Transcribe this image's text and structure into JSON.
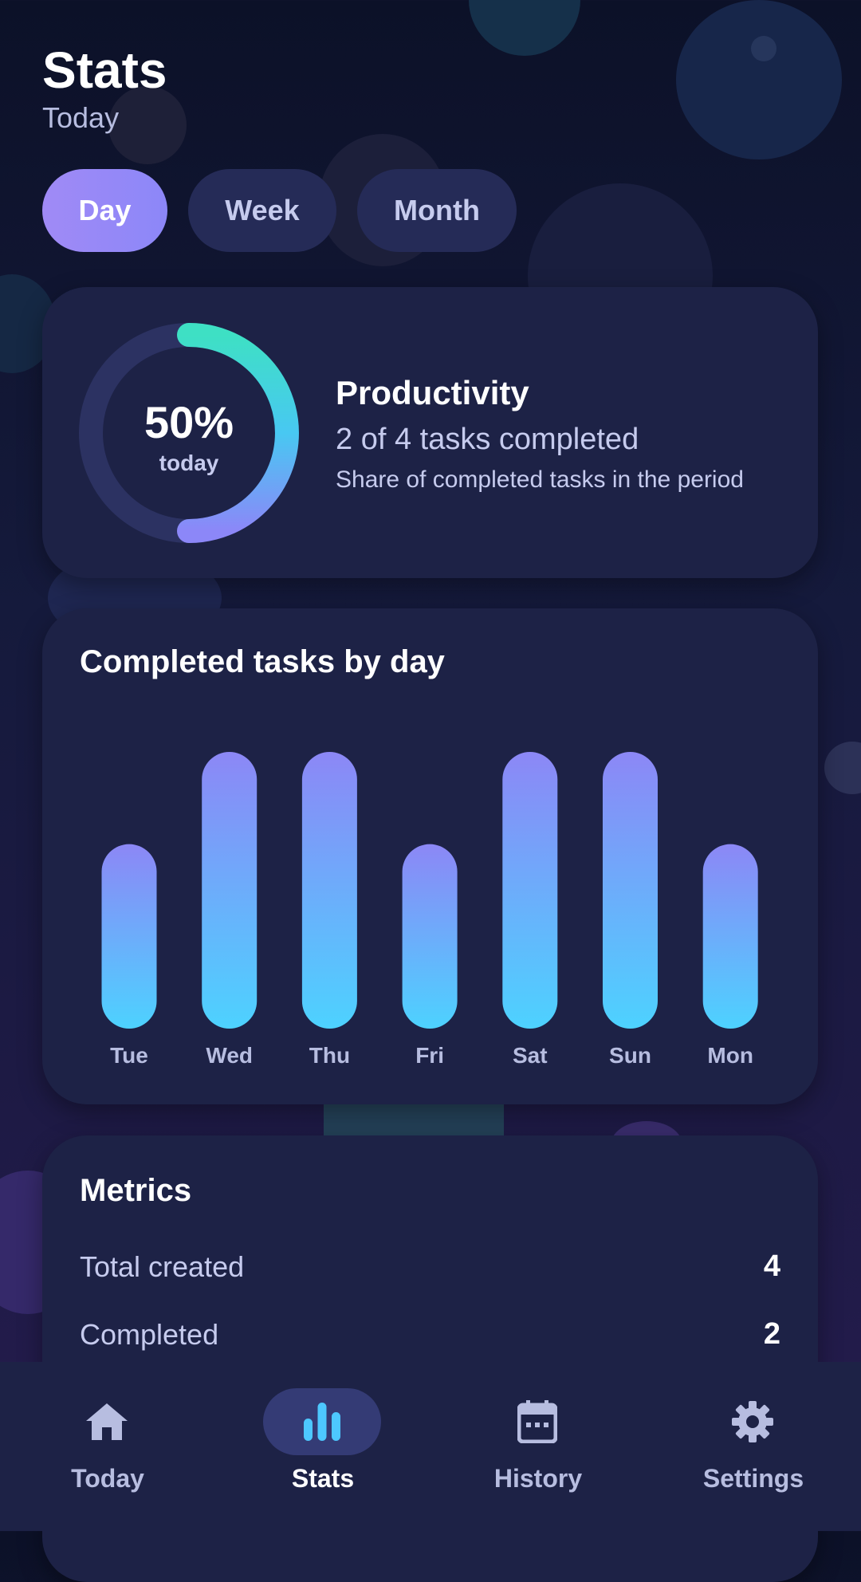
{
  "header": {
    "title": "Stats",
    "subtitle": "Today"
  },
  "filters": [
    {
      "label": "Day",
      "active": true
    },
    {
      "label": "Week",
      "active": false
    },
    {
      "label": "Month",
      "active": false
    }
  ],
  "productivity": {
    "percent_label": "50%",
    "percent_value": 50,
    "period_label": "today",
    "title": "Productivity",
    "summary": "2 of 4 tasks completed",
    "description": "Share of completed tasks in the period"
  },
  "chart_data": {
    "type": "bar",
    "title": "Completed tasks by day",
    "categories": [
      "Tue",
      "Wed",
      "Thu",
      "Fri",
      "Sat",
      "Sun",
      "Mon"
    ],
    "values": [
      2,
      3,
      3,
      2,
      3,
      3,
      2
    ],
    "ylim": [
      0,
      3
    ],
    "xlabel": "",
    "ylabel": "",
    "grid": false,
    "colors": {
      "top": "#8c87f6",
      "bottom": "#4dd2ff"
    }
  },
  "metrics": {
    "title": "Metrics",
    "rows": [
      {
        "label": "Total created",
        "value": "4"
      },
      {
        "label": "Completed",
        "value": "2"
      }
    ]
  },
  "nav": [
    {
      "label": "Today",
      "icon": "home-icon",
      "active": false
    },
    {
      "label": "Stats",
      "icon": "bar-chart-icon",
      "active": true
    },
    {
      "label": "History",
      "icon": "calendar-icon",
      "active": false
    },
    {
      "label": "Settings",
      "icon": "gear-icon",
      "active": false
    }
  ],
  "colors": {
    "accent": "#9b8af7",
    "ring_start": "#3ee0c4",
    "ring_end": "#8c87f8",
    "card": "#1d2246"
  }
}
